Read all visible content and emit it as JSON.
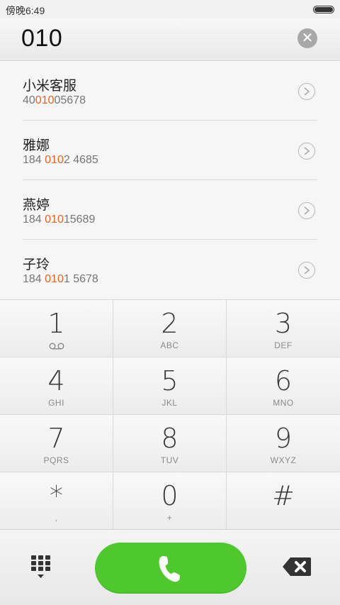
{
  "status": {
    "time": "傍晚6:49"
  },
  "input": {
    "number": "010"
  },
  "results": [
    {
      "name": "小米客服",
      "num_pre": "40",
      "num_hl": "010",
      "num_post": "05678"
    },
    {
      "name": "雅娜",
      "num_pre": "184 ",
      "num_hl": "010",
      "num_post": "2 4685"
    },
    {
      "name": "燕婷",
      "num_pre": "184 ",
      "num_hl": "010",
      "num_post": "15689"
    },
    {
      "name": "子玲",
      "num_pre": "184 ",
      "num_hl": "010",
      "num_post": "1 5678"
    }
  ],
  "keypad": [
    {
      "digit": "1",
      "letters": ""
    },
    {
      "digit": "2",
      "letters": "ABC"
    },
    {
      "digit": "3",
      "letters": "DEF"
    },
    {
      "digit": "4",
      "letters": "GHI"
    },
    {
      "digit": "5",
      "letters": "JKL"
    },
    {
      "digit": "6",
      "letters": "MNO"
    },
    {
      "digit": "7",
      "letters": "PQRS"
    },
    {
      "digit": "8",
      "letters": "TUV"
    },
    {
      "digit": "9",
      "letters": "WXYZ"
    },
    {
      "digit": "*",
      "letters": ","
    },
    {
      "digit": "0",
      "letters": "+"
    },
    {
      "digit": "#",
      "letters": ""
    }
  ],
  "icons": {
    "clear": "clear-icon",
    "detail": "chevron-right-icon",
    "voicemail": "voicemail-icon",
    "dialpad": "dialpad-icon",
    "call": "phone-icon",
    "backspace": "backspace-icon"
  },
  "colors": {
    "highlight": "#e8641e",
    "call": "#4ec82d"
  }
}
